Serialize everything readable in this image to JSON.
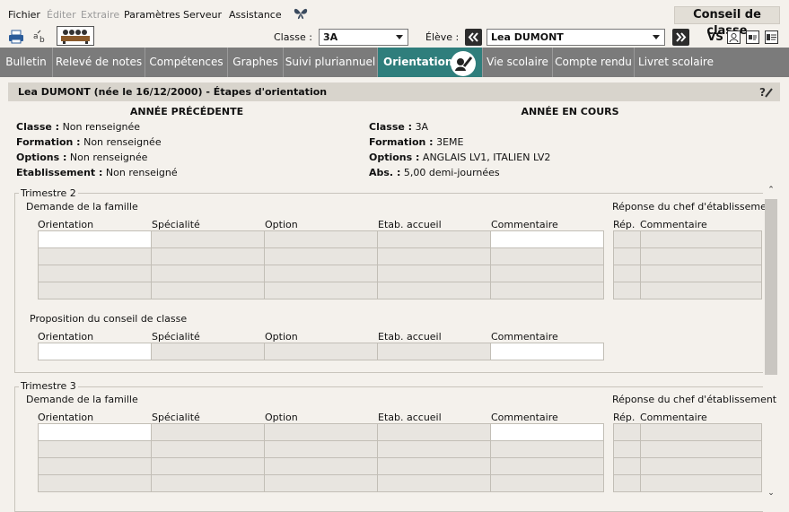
{
  "menu": {
    "items": [
      {
        "label": "Fichier",
        "disabled": false
      },
      {
        "label": "Éditer",
        "disabled": true
      },
      {
        "label": "Extraire",
        "disabled": true
      },
      {
        "label": "Paramètres",
        "disabled": false
      },
      {
        "label": "Serveur",
        "disabled": false
      },
      {
        "label": "Assistance",
        "disabled": false
      }
    ],
    "context_title": "Conseil de classe"
  },
  "toolbar": {
    "classe_label": "Classe :",
    "classe_value": "3A",
    "eleve_label": "Élève :",
    "eleve_value": "Lea DUMONT",
    "vs_label": "VS"
  },
  "tabs": [
    {
      "label": "Bulletin",
      "active": false
    },
    {
      "label": "Relevé de notes",
      "active": false
    },
    {
      "label": "Compétences",
      "active": false
    },
    {
      "label": "Graphes",
      "active": false
    },
    {
      "label": "Suivi pluriannuel",
      "active": false
    },
    {
      "label": "Orientation",
      "active": true
    },
    {
      "label": "Vie scolaire",
      "active": false
    },
    {
      "label": "Compte rendu",
      "active": false
    },
    {
      "label": "Livret scolaire",
      "active": false
    }
  ],
  "page": {
    "title": "Lea DUMONT (née le 16/12/2000) - Étapes d'orientation",
    "previous_year": {
      "header": "ANNÉE PRÉCÉDENTE",
      "classe_label": "Classe :",
      "classe_value": "Non renseignée",
      "formation_label": "Formation :",
      "formation_value": "Non renseignée",
      "options_label": "Options :",
      "options_value": "Non renseignée",
      "etab_label": "Etablissement :",
      "etab_value": "Non renseigné"
    },
    "current_year": {
      "header": "ANNÉE EN COURS",
      "classe_label": "Classe :",
      "classe_value": "3A",
      "formation_label": "Formation :",
      "formation_value": "3EME",
      "options_label": "Options :",
      "options_value": "ANGLAIS LV1, ITALIEN LV2",
      "abs_label": "Abs. :",
      "abs_value": "5,00 demi-journées"
    }
  },
  "columns": [
    "Orientation",
    "Spécialité",
    "Option",
    "Etab. accueil",
    "Commentaire"
  ],
  "reply_columns": [
    "Rép.",
    "Commentaire"
  ],
  "trimestre2": {
    "legend": "Trimestre 2",
    "demande": "Demande de la famille",
    "reponse": "Réponse du chef d'établissement",
    "proposition": "Proposition du conseil de classe"
  },
  "trimestre3": {
    "legend": "Trimestre 3",
    "demande": "Demande de la famille",
    "reponse": "Réponse du chef d'établissement"
  }
}
